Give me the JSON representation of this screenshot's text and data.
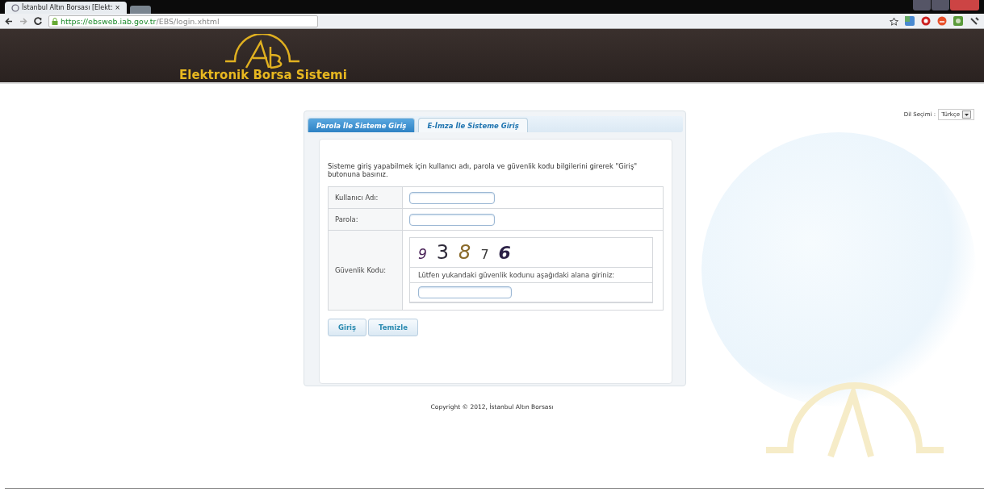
{
  "browser": {
    "tab_title": "İstanbul Altın Borsası [Elekt: ×",
    "url_host": "https://ebsweb.iab.gov.tr",
    "url_path": "/EBS/login.xhtml"
  },
  "header": {
    "title": "Elektronik Borsa Sistemi"
  },
  "language": {
    "label": "Dil Seçimi :",
    "value": "Türkçe"
  },
  "tabs": [
    {
      "label": "Parola İle Sisteme Giriş",
      "selected": true
    },
    {
      "label": "E-İmza İle Sisteme Giriş",
      "selected": false
    }
  ],
  "intro": "Sisteme giriş yapabilmek için kullanıcı adı, parola ve güvenlik kodu bilgilerini girerek \"Giriş\" butonuna basınız.",
  "fields": [
    {
      "label": "Kullanıcı Adı:"
    },
    {
      "label": "Parola:"
    }
  ],
  "captcha": {
    "label": "Güvenlik Kodu:",
    "digits": [
      {
        "text": "9",
        "color": "#4a2358"
      },
      {
        "text": "3",
        "color": "#2e2a3a"
      },
      {
        "text": "8",
        "color": "#8a6a2a"
      },
      {
        "text": "7",
        "color": "#3a3a3a"
      },
      {
        "text": "6",
        "color": "#2a1f45"
      }
    ],
    "hint": "Lütfen yukandaki güvenlik kodunu aşağıdaki alana giriniz:"
  },
  "buttons": [
    "Giriş",
    "Temizle"
  ],
  "footer": "Copyright © 2012, İstanbul Altın Borsası"
}
